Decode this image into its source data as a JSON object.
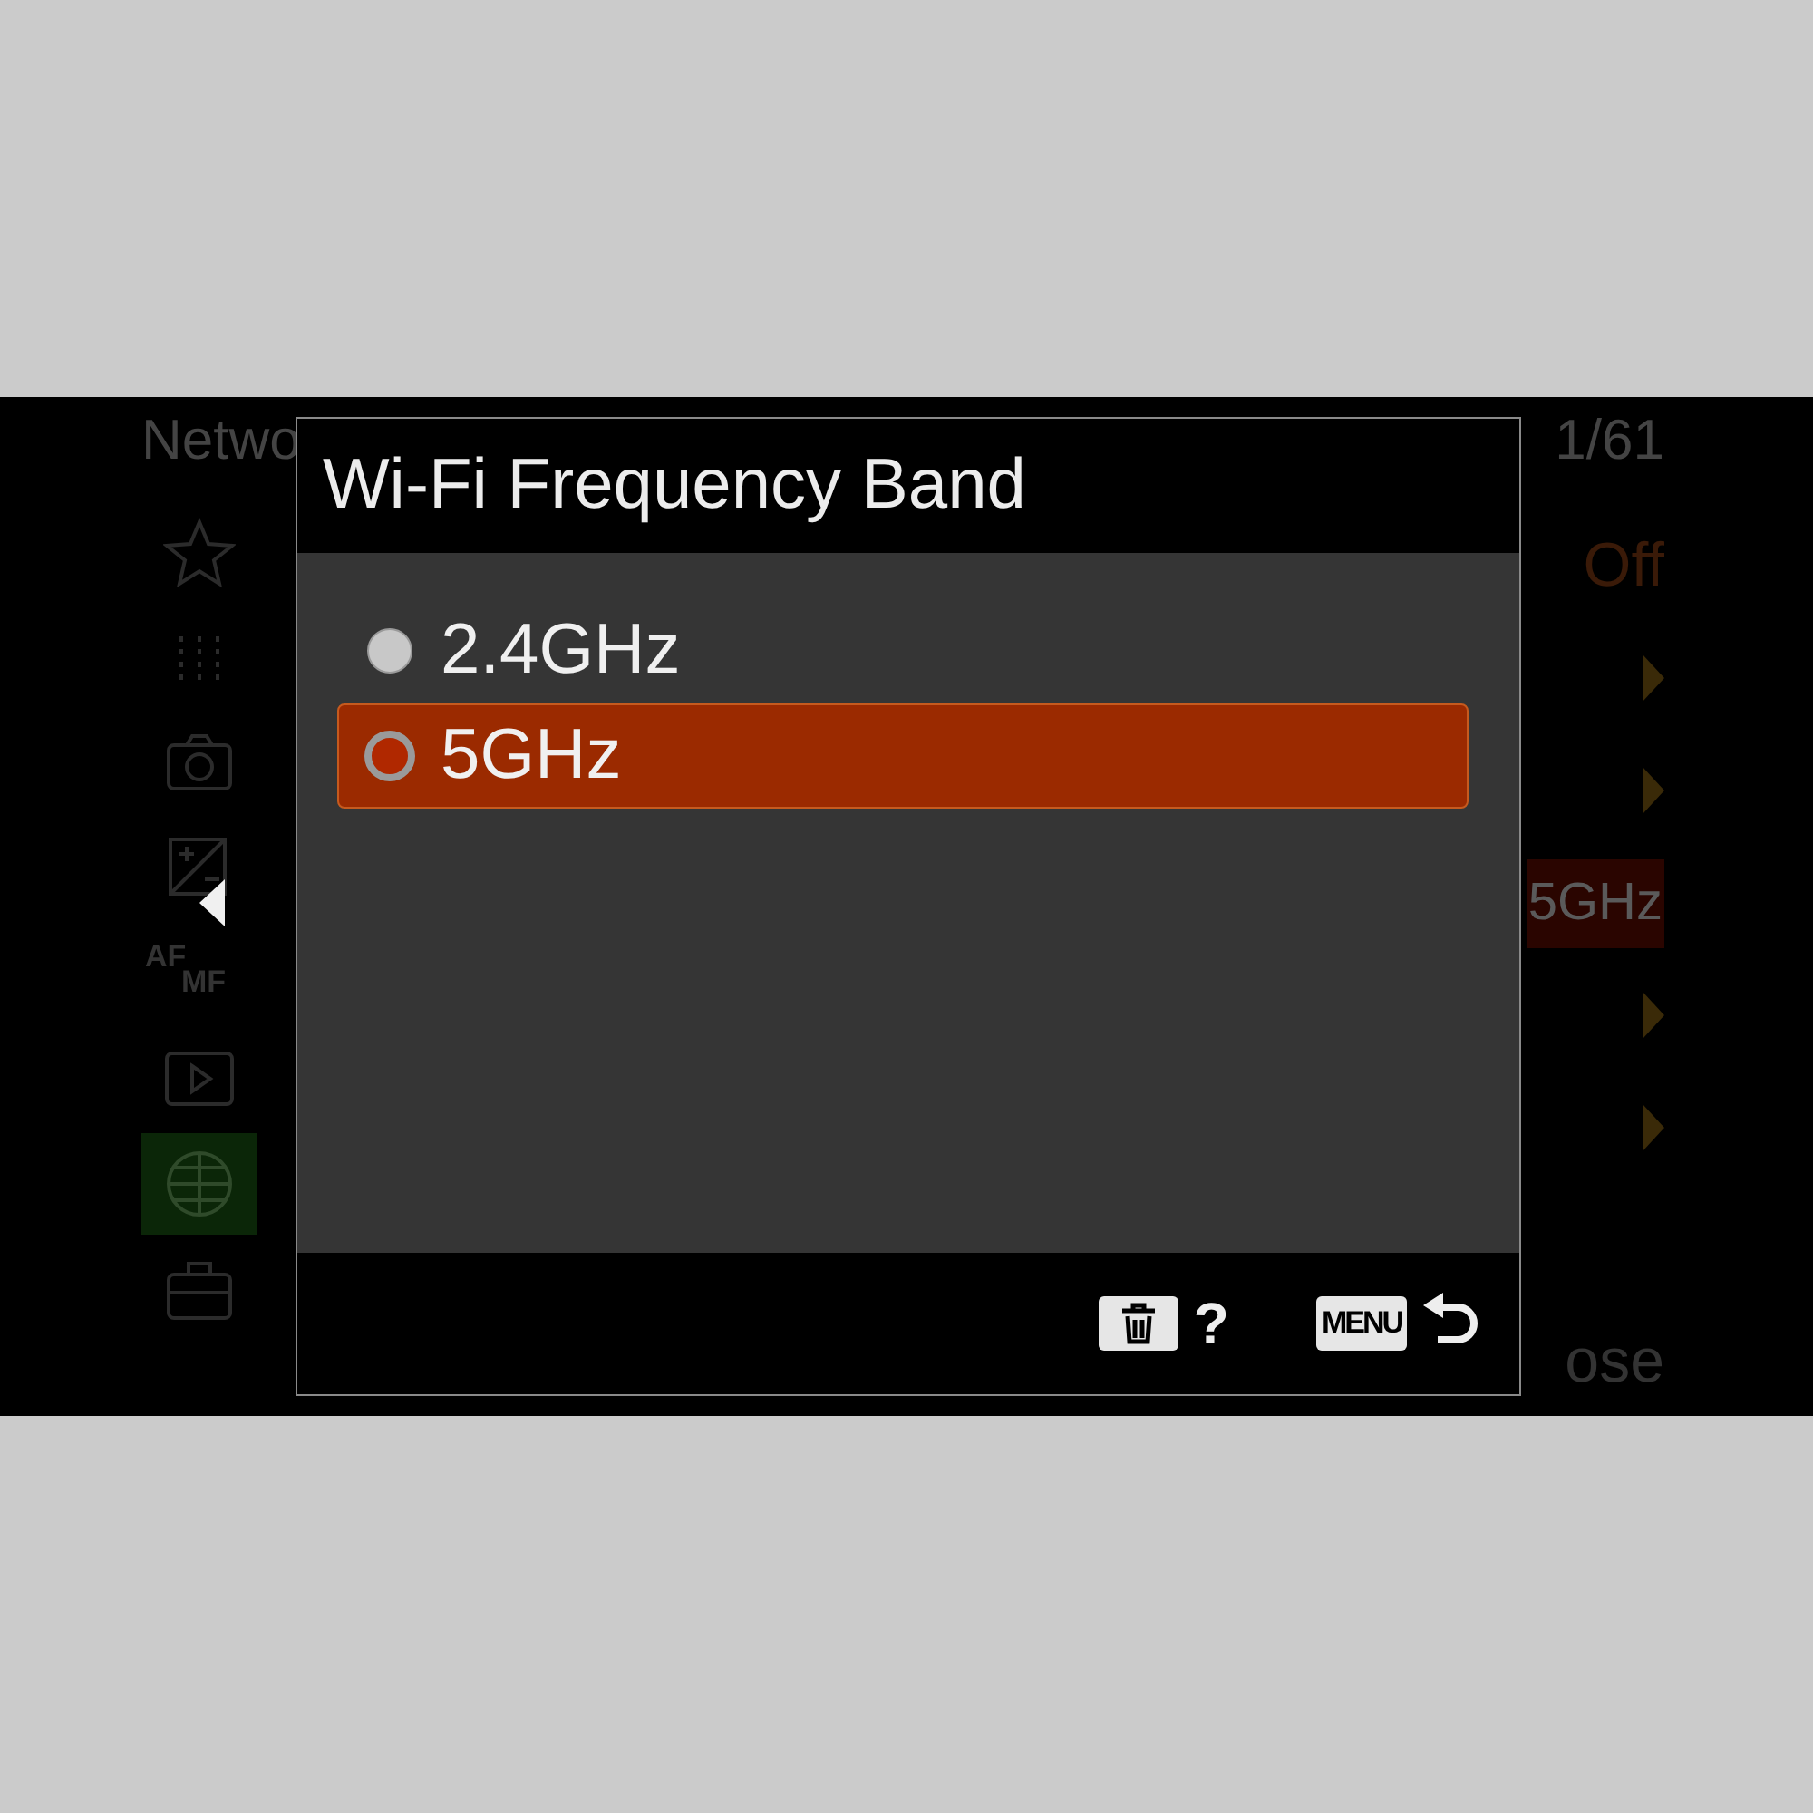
{
  "background": {
    "title": "Netwo",
    "page": "1/61",
    "sidebar": [
      {
        "kind": "star",
        "selected": false
      },
      {
        "kind": "dots",
        "selected": false
      },
      {
        "kind": "camera",
        "selected": false
      },
      {
        "kind": "exposure",
        "selected": false
      },
      {
        "kind": "afmf",
        "texts": [
          "AF",
          "MF"
        ],
        "selected": false
      },
      {
        "kind": "play",
        "selected": false
      },
      {
        "kind": "globe",
        "selected": true
      },
      {
        "kind": "toolbox",
        "selected": false
      }
    ],
    "values": [
      {
        "kind": "text",
        "text": "Off"
      },
      {
        "kind": "arrow"
      },
      {
        "kind": "arrow"
      },
      {
        "kind": "badge",
        "text": "5GHz"
      },
      {
        "kind": "arrow"
      },
      {
        "kind": "arrow"
      }
    ],
    "close": "ose"
  },
  "dialog": {
    "title": "Wi-Fi Frequency Band",
    "options": [
      {
        "label": "2.4GHz",
        "selected": false
      },
      {
        "label": "5GHz",
        "selected": true
      }
    ],
    "footer": {
      "help": "?",
      "menu_key": "MENU"
    }
  }
}
